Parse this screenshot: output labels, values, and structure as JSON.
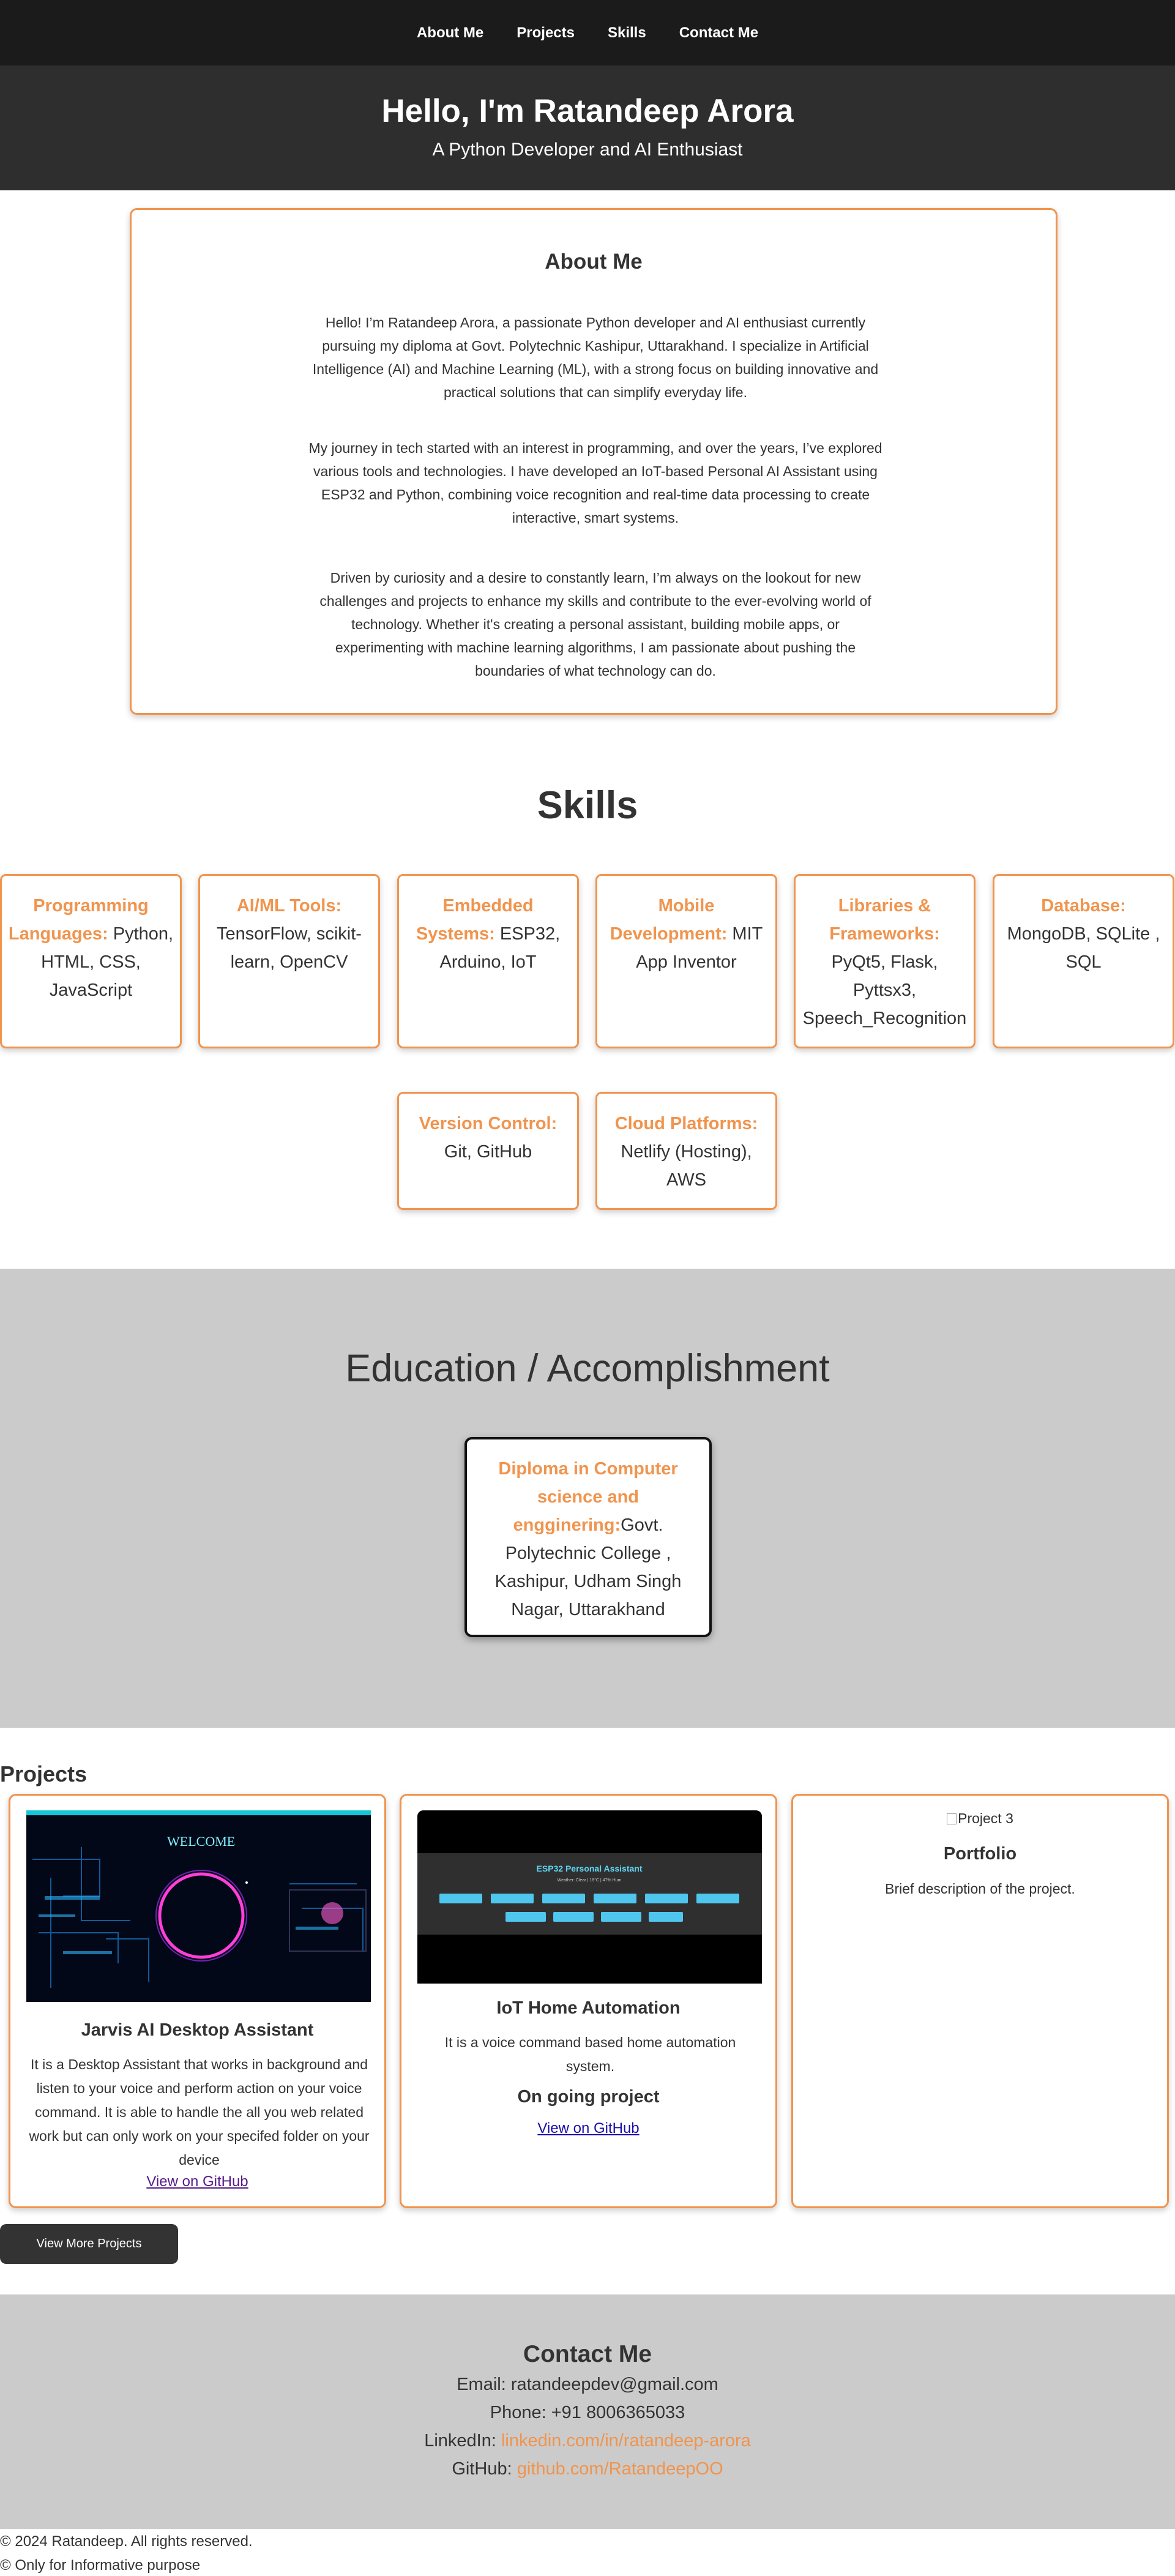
{
  "nav": {
    "items": [
      "About Me",
      "Projects",
      "Skills",
      "Contact Me"
    ]
  },
  "hero": {
    "title": "Hello, I'm Ratandeep Arora",
    "subtitle": "A Python Developer and AI Enthusiast"
  },
  "about": {
    "title": "About Me",
    "paragraphs": [
      "Hello! I’m Ratandeep Arora, a passionate Python developer and AI enthusiast currently pursuing my diploma at Govt. Polytechnic Kashipur, Uttarakhand. I specialize in Artificial Intelligence (AI) and Machine Learning (ML), with a strong focus on building innovative and practical solutions that can simplify everyday life.",
      "My journey in tech started with an interest in programming, and over the years, I’ve explored various tools and technologies. I have developed an IoT-based Personal AI Assistant using ESP32 and Python, combining voice recognition and real-time data processing to create interactive, smart systems.",
      "Driven by curiosity and a desire to constantly learn, I’m always on the lookout for new challenges and projects to enhance my skills and contribute to the ever-evolving world of technology. Whether it's creating a personal assistant, building mobile apps, or experimenting with machine learning algorithms, I am passionate about pushing the boundaries of what technology can do."
    ]
  },
  "skills": {
    "title": "Skills",
    "items": [
      {
        "key": "Programming Languages:",
        "value": " Python, HTML, CSS, JavaScript"
      },
      {
        "key": "AI/ML Tools:",
        "value": " TensorFlow, scikit-learn, OpenCV"
      },
      {
        "key": "Embedded Systems:",
        "value": " ESP32, Arduino, IoT"
      },
      {
        "key": "Mobile Development:",
        "value": " MIT App Inventor"
      },
      {
        "key": "Libraries & Frameworks:",
        "value": " PyQt5, Flask, Pyttsx3, Speech_Recognition"
      },
      {
        "key": "Database:",
        "value": " MongoDB, SQLite , SQL"
      },
      {
        "key": "Version Control:",
        "value": " Git, GitHub"
      },
      {
        "key": "Cloud Platforms:",
        "value": " Netlify (Hosting), AWS"
      }
    ]
  },
  "education": {
    "title": "Education / Accomplishment",
    "key": "Diploma in Computer science and engginering:",
    "value": "Govt. Polytechnic College , Kashipur, Udham Singh Nagar, Uttarakhand"
  },
  "projects": {
    "title": "Projects",
    "items": [
      {
        "title": "Jarvis AI Desktop Assistant",
        "description": "It is a Desktop Assistant that works in background and listen to your voice and perform action on your voice command. It is able to handle the all you web related work but can only work on your specifed folder on your device",
        "link": "View on GitHub",
        "thumb_text": "WELCOME"
      },
      {
        "title": "IoT Home Automation",
        "description": "It is a voice command based home automation system.",
        "status": "On going project",
        "link": "View on GitHub",
        "thumb_title": "ESP32 Personal Assistant",
        "thumb_subtitle": "Weather: Clear | 18°C | 47% Hum"
      },
      {
        "image_alt": "Project 3",
        "title": "Portfolio",
        "description": "Brief description of the project."
      }
    ],
    "view_more": "View More Projects"
  },
  "contact": {
    "title": "Contact Me",
    "email_label": "Email: ",
    "email": "ratandeepdev@gmail.com",
    "phone_label": "Phone: ",
    "phone": "+91 8006365033",
    "linkedin_label": "LinkedIn: ",
    "linkedin": "linkedin.com/in/ratandeep-arora",
    "github_label": "GitHub: ",
    "github": "github.com/RatandeepOO"
  },
  "footer": {
    "line1": "© 2024 Ratandeep. All rights reserved.",
    "line2": "© Only for Informative purpose"
  },
  "colors": {
    "accent": "#f0944e",
    "nav_bg": "#1b1b1b",
    "hero_bg": "#2e2e2e",
    "section_gray": "#cbcbcb"
  }
}
